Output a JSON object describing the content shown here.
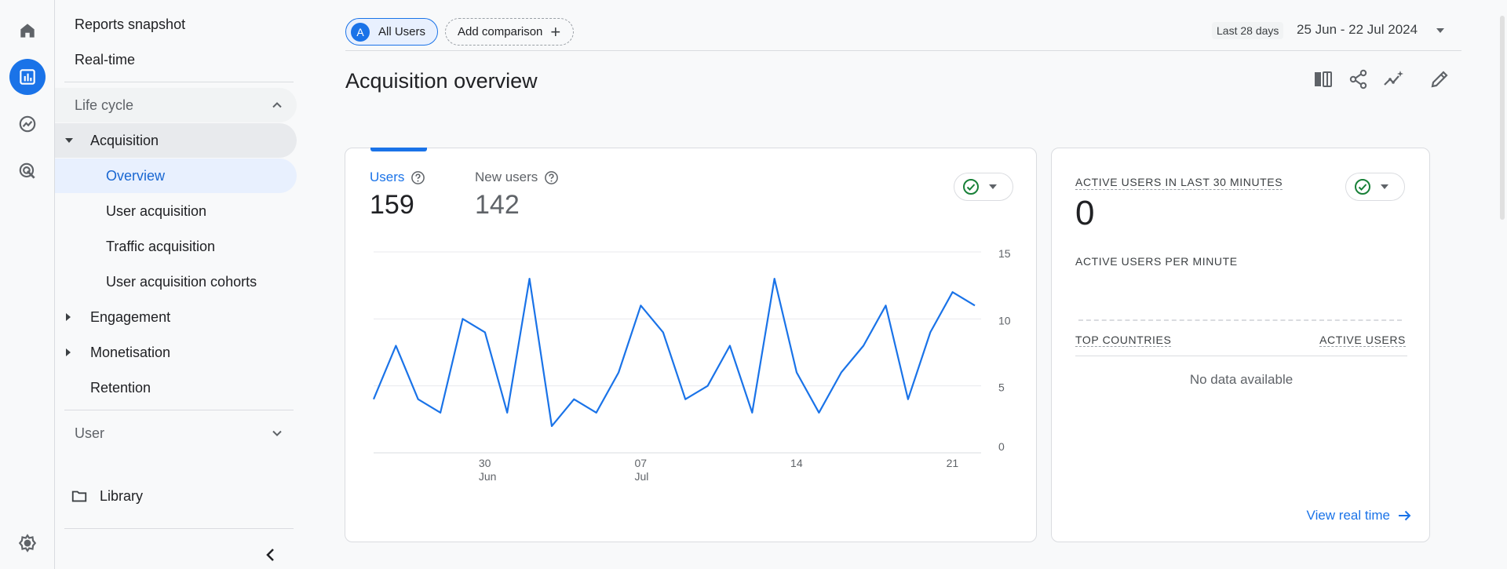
{
  "nav": {
    "reports_snapshot": "Reports snapshot",
    "realtime": "Real-time",
    "lifecycle": "Life cycle",
    "acquisition": "Acquisition",
    "overview": "Overview",
    "user_acquisition": "User acquisition",
    "traffic_acquisition": "Traffic acquisition",
    "user_acquisition_cohorts": "User acquisition cohorts",
    "engagement": "Engagement",
    "monetisation": "Monetisation",
    "retention": "Retention",
    "user": "User",
    "library": "Library"
  },
  "topbar": {
    "segment_avatar": "A",
    "segment_label": "All Users",
    "add_comparison": "Add comparison",
    "date_chip": "Last 28 days",
    "date_range": "25 Jun - 22 Jul 2024"
  },
  "page_title": "Acquisition overview",
  "metrics": {
    "users_label": "Users",
    "users_value": "159",
    "new_users_label": "New users",
    "new_users_value": "142"
  },
  "realtime": {
    "title": "ACTIVE USERS IN LAST 30 MINUTES",
    "value": "0",
    "per_minute": "ACTIVE USERS PER MINUTE",
    "col_countries": "TOP COUNTRIES",
    "col_users": "ACTIVE USERS",
    "no_data": "No data available",
    "view_link": "View real time"
  },
  "colors": {
    "accent": "#1a73e8",
    "success": "#188038",
    "line": "#1a73e8"
  },
  "chart_data": {
    "type": "line",
    "series": [
      {
        "values": [
          4,
          8,
          4,
          3,
          10,
          9,
          3,
          13,
          2,
          4,
          3,
          6,
          11,
          9,
          4,
          5,
          8,
          3,
          13,
          6,
          3,
          6,
          8,
          11,
          4,
          9,
          12,
          11
        ]
      }
    ],
    "x_tick_labels": [
      {
        "day": "30",
        "month": "Jun"
      },
      {
        "day": "07",
        "month": "Jul"
      },
      {
        "day": "14",
        "month": ""
      },
      {
        "day": "21",
        "month": ""
      }
    ],
    "x_tick_indices": [
      5,
      12,
      19,
      26
    ],
    "y_ticks": [
      0,
      5,
      10,
      15
    ],
    "ylim": [
      0,
      15
    ],
    "grid": true
  }
}
